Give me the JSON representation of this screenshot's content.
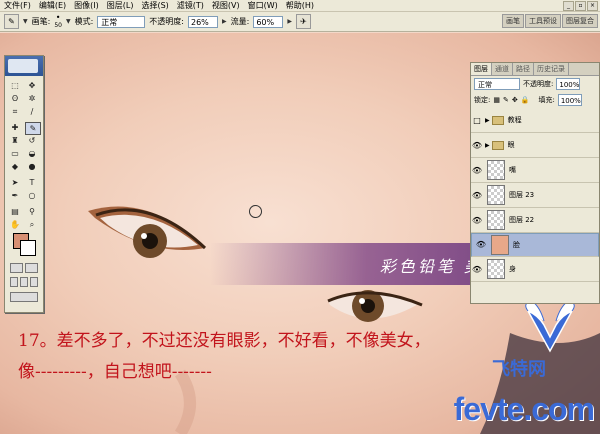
{
  "menubar": {
    "items": [
      "文件(F)",
      "编辑(E)",
      "图像(I)",
      "图层(L)",
      "选择(S)",
      "滤镜(T)",
      "视图(V)",
      "窗口(W)",
      "帮助(H)"
    ]
  },
  "options": {
    "brush_label": "画笔:",
    "brush_size": "50",
    "mode_label": "模式:",
    "mode_value": "正常",
    "opacity_label": "不透明度:",
    "opacity_value": "26%",
    "flow_label": "流量:",
    "flow_value": "60%",
    "well_tabs": [
      "画笔",
      "工具预设",
      "图层复合"
    ]
  },
  "layers_panel": {
    "tabs": [
      "图层",
      "通道",
      "路径",
      "历史记录"
    ],
    "blend_mode": "正常",
    "opacity_label": "不透明度:",
    "opacity_value": "100%",
    "lock_label": "锁定:",
    "fill_label": "填充:",
    "fill_value": "100%",
    "layers": [
      {
        "name": "教程",
        "type": "group",
        "visible": false
      },
      {
        "name": "眼",
        "type": "group",
        "visible": true
      },
      {
        "name": "嘴",
        "type": "layer",
        "visible": true
      },
      {
        "name": "图层 23",
        "type": "layer",
        "visible": true
      },
      {
        "name": "图层 22",
        "type": "layer",
        "visible": true
      },
      {
        "name": "脸",
        "type": "layer",
        "visible": true,
        "selected": true
      },
      {
        "name": "身",
        "type": "layer",
        "visible": true
      }
    ]
  },
  "banner": "彩色铅笔 美女 原创教程",
  "caption": {
    "line1": "17。差不多了，不过还没有眼影，不好看，不像美女，",
    "line2": "像---------，自己想吧-------"
  },
  "logo": {
    "cn": "飞特网",
    "url": "fevte.com"
  },
  "colors": {
    "foreground": "#d78f73",
    "background": "#ffffff",
    "caption": "#c2141c",
    "logo": "#3a6ad6"
  }
}
